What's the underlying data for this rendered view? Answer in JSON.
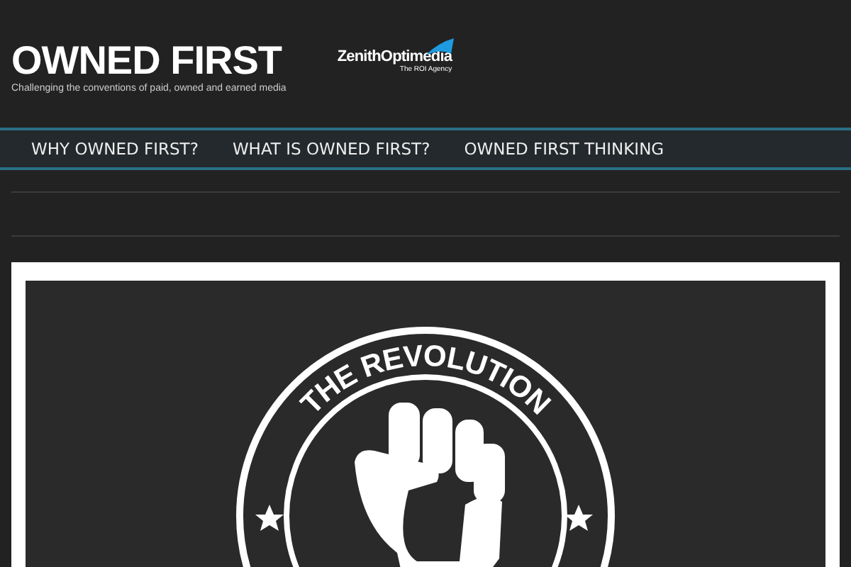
{
  "header": {
    "title": "OWNED FIRST",
    "tagline": "Challenging the conventions of paid, owned and earned media",
    "partner": {
      "name": "ZenithOptimedia",
      "subtitle": "The ROI Agency"
    }
  },
  "nav": {
    "items": [
      {
        "label": "WHY OWNED FIRST?"
      },
      {
        "label": "WHAT IS OWNED FIRST?"
      },
      {
        "label": "OWNED FIRST THINKING"
      }
    ]
  },
  "hero": {
    "badge_text": "THE REVOLUTION"
  }
}
